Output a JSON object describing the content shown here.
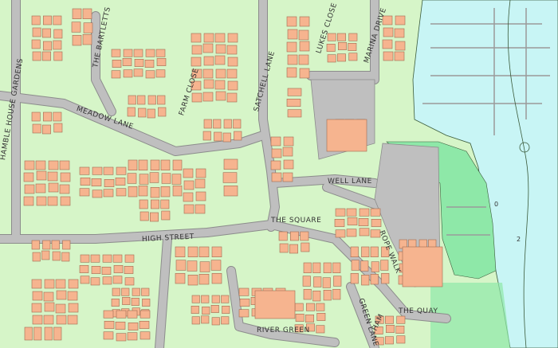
{
  "map": {
    "colors": {
      "land": "#d6f5c8",
      "road": "#bfbfbf",
      "road_edge": "#8c8c8c",
      "building": "#f6b48f",
      "building_edge": "#a06a50",
      "water": "#c8f5f5",
      "park": "#8ee8a8",
      "contour": "#3a5a3a"
    },
    "streets": {
      "hamble_house_gardens": "HAMBLE HOUSE GARDENS",
      "the_bartletts": "THE BARTLETTS",
      "meadow_lane": "MEADOW LANE",
      "farm_close": "FARM CLOSE",
      "satchell_lane": "SATCHELL LANE",
      "lukes_close": "LUKES CLOSE",
      "marina_drive": "MARINA DRIVE",
      "well_lane": "WELL LANE",
      "the_square": "THE SQUARE",
      "high_street": "HIGH STREET",
      "rope_walk": "ROPE WALK",
      "the_quay": "THE QUAY",
      "river_green": "RIVER GREEN",
      "green_lane": "GREEN LANE",
      "ham": "HAM"
    },
    "depth_marks": [
      "0",
      "2"
    ]
  }
}
